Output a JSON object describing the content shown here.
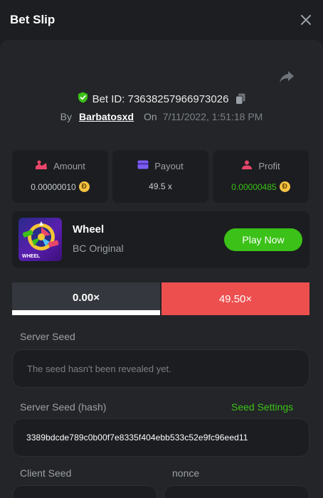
{
  "header": {
    "title": "Bet Slip"
  },
  "bet": {
    "id_label": "Bet ID: 73638257966973026",
    "by_label": "By",
    "user": "Barbatosxd",
    "on_label": "On",
    "date": "7/11/2022, 1:51:18 PM"
  },
  "stats": {
    "amount": {
      "label": "Amount",
      "value": "0.00000010"
    },
    "payout": {
      "label": "Payout",
      "value": "49.5 x"
    },
    "profit": {
      "label": "Profit",
      "value": "0.00000485"
    }
  },
  "coin_symbol": "Đ",
  "game": {
    "name": "Wheel",
    "provider": "BC Original",
    "play_label": "Play Now",
    "thumb_text": "WHEEL"
  },
  "multipliers": {
    "left": "0.00×",
    "right": "49.50×"
  },
  "fields": {
    "server_seed": {
      "label": "Server Seed",
      "placeholder": "The seed hasn't been revealed yet."
    },
    "server_seed_hash": {
      "label": "Server Seed (hash)",
      "value": "3389bdcde789c0b00f7e8335f404ebb533c52e9fc96eed11",
      "settings_label": "Seed Settings"
    },
    "client_seed": {
      "label": "Client Seed"
    },
    "nonce": {
      "label": "nonce"
    }
  },
  "colors": {
    "accent_green": "#3bc117",
    "danger_red": "#ed4f4f",
    "profit_green": "#3bc117",
    "coin_gold": "#f6c343"
  }
}
